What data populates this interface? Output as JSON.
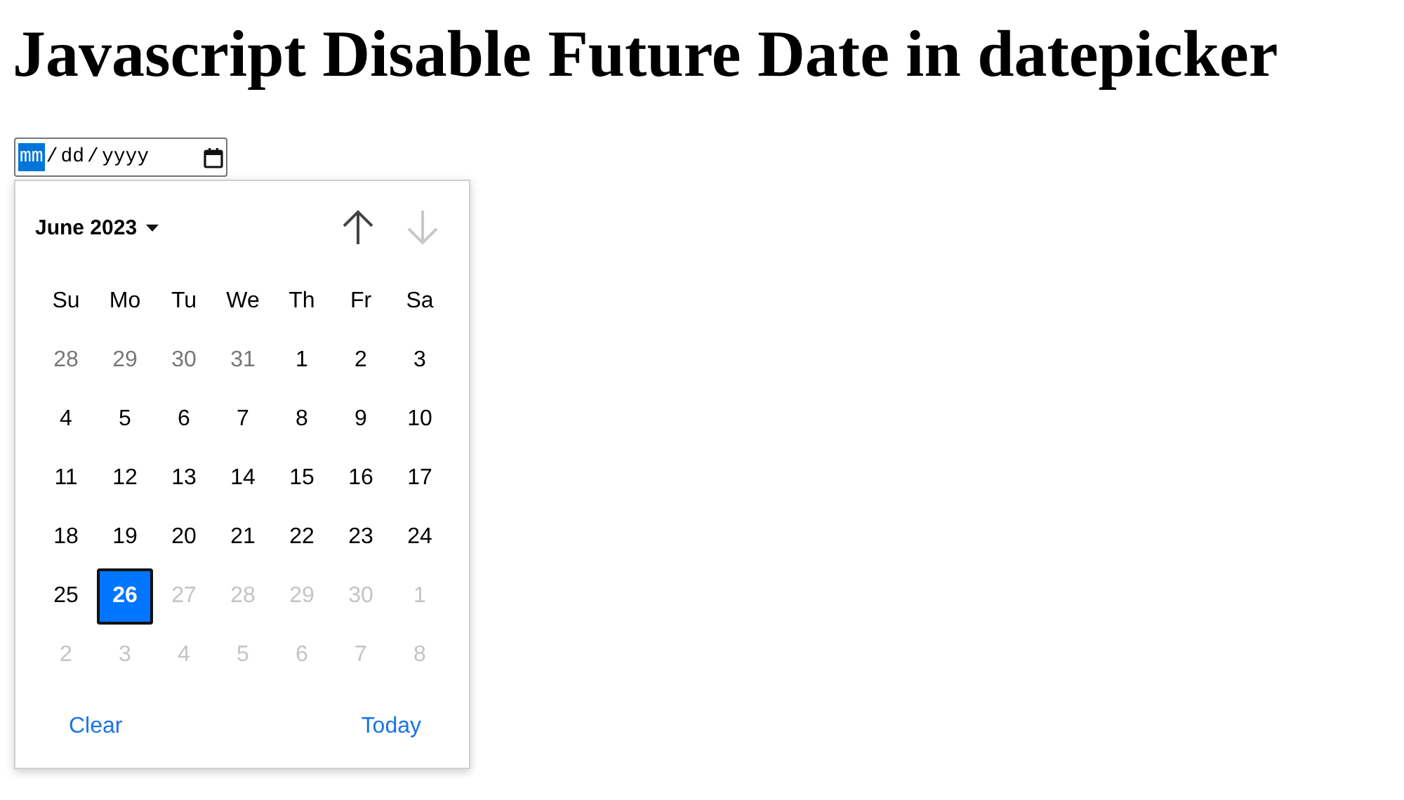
{
  "title": "Javascript Disable Future Date in datepicker",
  "date_field": {
    "segments": [
      {
        "text": "mm",
        "selected": true
      },
      {
        "text": "dd",
        "selected": false
      },
      {
        "text": "yyyy",
        "selected": false
      }
    ],
    "separator": "/"
  },
  "calendar": {
    "month_label": "June 2023",
    "prev": {
      "disabled": false
    },
    "next": {
      "disabled": true
    },
    "weekdays": [
      "Su",
      "Mo",
      "Tu",
      "We",
      "Th",
      "Fr",
      "Sa"
    ],
    "days": [
      {
        "text": "28",
        "kind": "outside",
        "selected": false
      },
      {
        "text": "29",
        "kind": "outside",
        "selected": false
      },
      {
        "text": "30",
        "kind": "outside",
        "selected": false
      },
      {
        "text": "31",
        "kind": "outside",
        "selected": false
      },
      {
        "text": "1",
        "kind": "normal",
        "selected": false
      },
      {
        "text": "2",
        "kind": "normal",
        "selected": false
      },
      {
        "text": "3",
        "kind": "normal",
        "selected": false
      },
      {
        "text": "4",
        "kind": "normal",
        "selected": false
      },
      {
        "text": "5",
        "kind": "normal",
        "selected": false
      },
      {
        "text": "6",
        "kind": "normal",
        "selected": false
      },
      {
        "text": "7",
        "kind": "normal",
        "selected": false
      },
      {
        "text": "8",
        "kind": "normal",
        "selected": false
      },
      {
        "text": "9",
        "kind": "normal",
        "selected": false
      },
      {
        "text": "10",
        "kind": "normal",
        "selected": false
      },
      {
        "text": "11",
        "kind": "normal",
        "selected": false
      },
      {
        "text": "12",
        "kind": "normal",
        "selected": false
      },
      {
        "text": "13",
        "kind": "normal",
        "selected": false
      },
      {
        "text": "14",
        "kind": "normal",
        "selected": false
      },
      {
        "text": "15",
        "kind": "normal",
        "selected": false
      },
      {
        "text": "16",
        "kind": "normal",
        "selected": false
      },
      {
        "text": "17",
        "kind": "normal",
        "selected": false
      },
      {
        "text": "18",
        "kind": "normal",
        "selected": false
      },
      {
        "text": "19",
        "kind": "normal",
        "selected": false
      },
      {
        "text": "20",
        "kind": "normal",
        "selected": false
      },
      {
        "text": "21",
        "kind": "normal",
        "selected": false
      },
      {
        "text": "22",
        "kind": "normal",
        "selected": false
      },
      {
        "text": "23",
        "kind": "normal",
        "selected": false
      },
      {
        "text": "24",
        "kind": "normal",
        "selected": false
      },
      {
        "text": "25",
        "kind": "normal",
        "selected": false
      },
      {
        "text": "26",
        "kind": "normal",
        "selected": true
      },
      {
        "text": "27",
        "kind": "disabled",
        "selected": false
      },
      {
        "text": "28",
        "kind": "disabled",
        "selected": false
      },
      {
        "text": "29",
        "kind": "disabled",
        "selected": false
      },
      {
        "text": "30",
        "kind": "disabled",
        "selected": false
      },
      {
        "text": "1",
        "kind": "disabled",
        "selected": false
      },
      {
        "text": "2",
        "kind": "disabled",
        "selected": false
      },
      {
        "text": "3",
        "kind": "disabled",
        "selected": false
      },
      {
        "text": "4",
        "kind": "disabled",
        "selected": false
      },
      {
        "text": "5",
        "kind": "disabled",
        "selected": false
      },
      {
        "text": "6",
        "kind": "disabled",
        "selected": false
      },
      {
        "text": "7",
        "kind": "disabled",
        "selected": false
      },
      {
        "text": "8",
        "kind": "disabled",
        "selected": false
      }
    ],
    "footer": {
      "clear": "Clear",
      "today": "Today"
    }
  }
}
